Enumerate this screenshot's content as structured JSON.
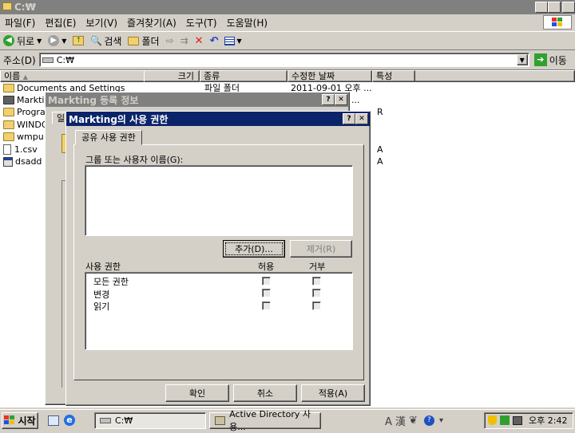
{
  "window": {
    "title": "C:₩"
  },
  "menu": [
    "파일(F)",
    "편집(E)",
    "보기(V)",
    "즐겨찾기(A)",
    "도구(T)",
    "도움말(H)"
  ],
  "toolbar": {
    "back": "뒤로",
    "search": "검색",
    "folders": "폴더"
  },
  "address": {
    "label": "주소(D)",
    "value": "C:₩",
    "go": "이동"
  },
  "columns": [
    "이름",
    "크기",
    "종류",
    "수정한 날짜",
    "특성"
  ],
  "files": [
    {
      "name": "Documents and Settings",
      "type": "파일 폴더",
      "date": "2011-09-01 오후 ...",
      "attr": ""
    },
    {
      "name": "Markting",
      "type": "",
      "date": "...",
      "attr": ""
    },
    {
      "name": "Progra",
      "type": "",
      "date": "",
      "attr": "R"
    },
    {
      "name": "WINDO",
      "type": "",
      "date": "",
      "attr": ""
    },
    {
      "name": "wmpu",
      "type": "",
      "date": "",
      "attr": ""
    },
    {
      "name": "1.csv",
      "type": "",
      "date": "",
      "attr": "A"
    },
    {
      "name": "dsadd",
      "type": "",
      "date": "",
      "attr": "A"
    }
  ],
  "props_dialog": {
    "title": "Markting 등록 정보",
    "tab_stub": "일"
  },
  "perm_dialog": {
    "title": "Markting의 사용 권한",
    "tab": "공유 사용 권한",
    "group_label": "그룹 또는 사용자 이름(G):",
    "add": "추가(D)...",
    "remove": "제거(R)",
    "perm_label": "사용 권한",
    "allow": "허용",
    "deny": "거부",
    "perms": [
      "모든 권한",
      "변경",
      "읽기"
    ],
    "ok": "확인",
    "cancel": "취소",
    "apply": "적용(A)"
  },
  "taskbar": {
    "start": "시작",
    "tasks": [
      "C:₩",
      "Active Directory 사용..."
    ],
    "ime": "A 漢",
    "clock": "오후 2:42"
  }
}
